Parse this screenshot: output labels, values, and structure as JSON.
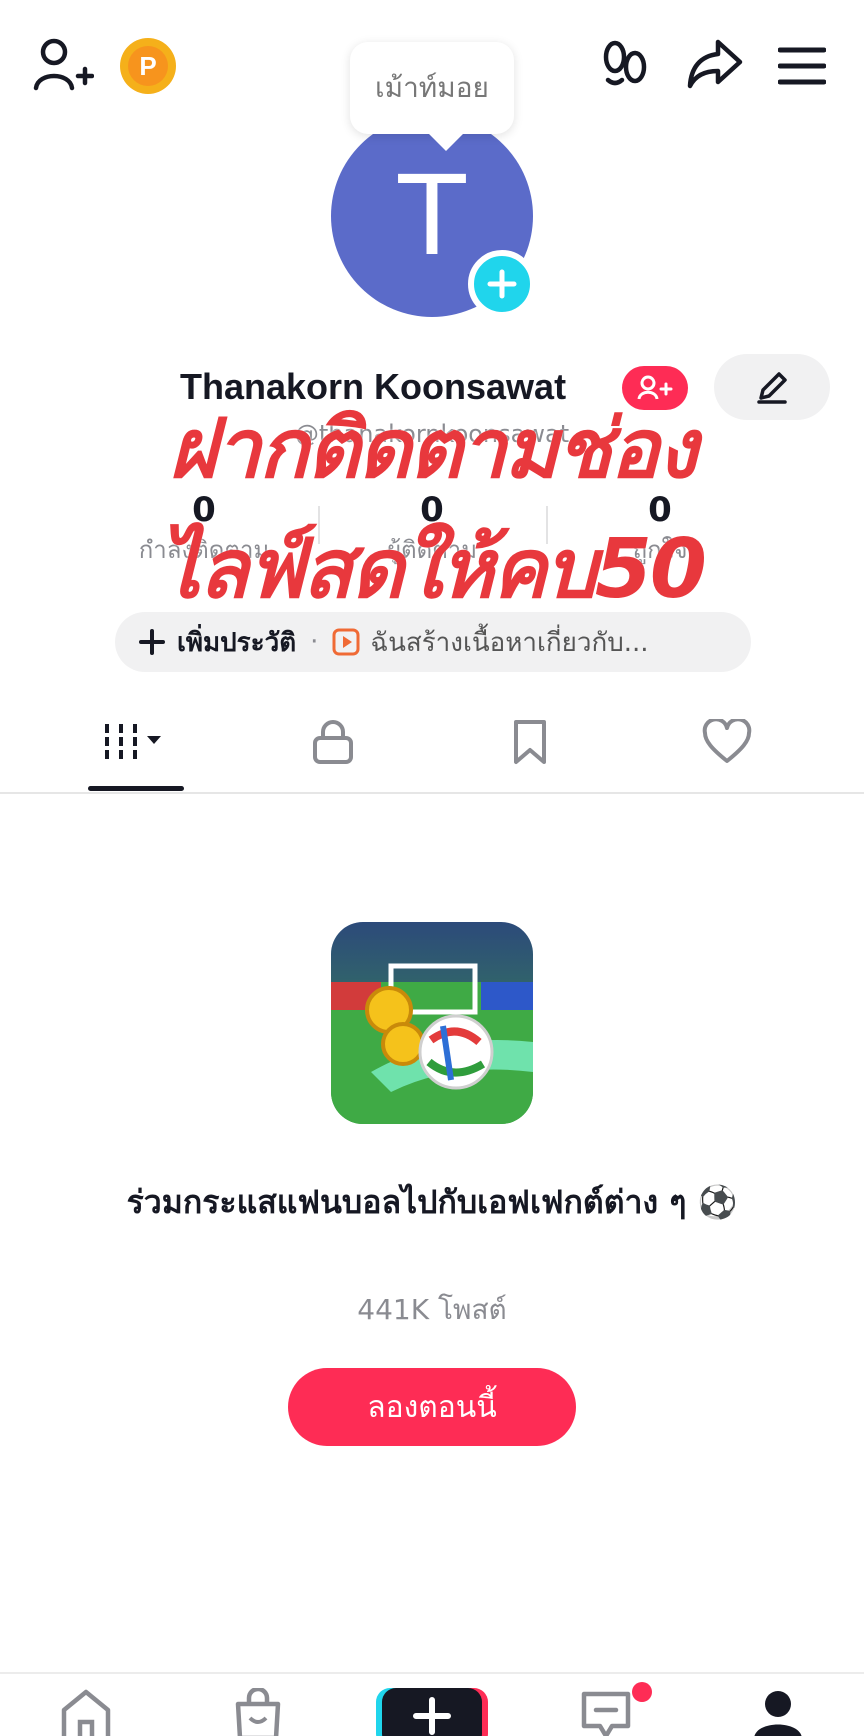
{
  "top_bar": {
    "coin_letter": "P",
    "icons": [
      "add-friend-icon",
      "coin-icon",
      "footprints-icon",
      "share-icon",
      "menu-icon"
    ]
  },
  "profile": {
    "note": "เม้าท์มอย",
    "avatar_letter": "T",
    "display_name": "Thanakorn Koonsawat",
    "username": "@thanakornkoonsawat",
    "stats": [
      {
        "value": "0",
        "label": "กำลังติดตาม"
      },
      {
        "value": "0",
        "label": "ผู้ติดตาม"
      },
      {
        "value": "0",
        "label": "ถูกใจ"
      }
    ],
    "bio_add_label": "เพิ่มประวัติ",
    "bio_separator": "·",
    "bio_description": "ฉันสร้างเนื้อหาเกี่ยวกับ..."
  },
  "overlay": {
    "line1": "ฝากติดตามช่อง",
    "line2": "ไลฟ์สดให้คบ50",
    "color": "#e8383d"
  },
  "tabs": [
    "videos-grid-icon",
    "private-lock-icon",
    "saved-bookmark-icon",
    "liked-heart-icon"
  ],
  "promo": {
    "title": "ร่วมกระแสแฟนบอลไปกับเอฟเฟกต์ต่าง ๆ ⚽",
    "post_count": "441K โพสต์",
    "button_label": "ลองตอนนี้"
  },
  "bottom_nav": [
    "home-icon",
    "shop-icon",
    "create-icon",
    "inbox-icon",
    "profile-icon"
  ],
  "colors": {
    "accent": "#fe2c55",
    "cyan": "#20d5ec",
    "avatar_bg": "#5b6bc9",
    "coin": "#f7941d"
  }
}
